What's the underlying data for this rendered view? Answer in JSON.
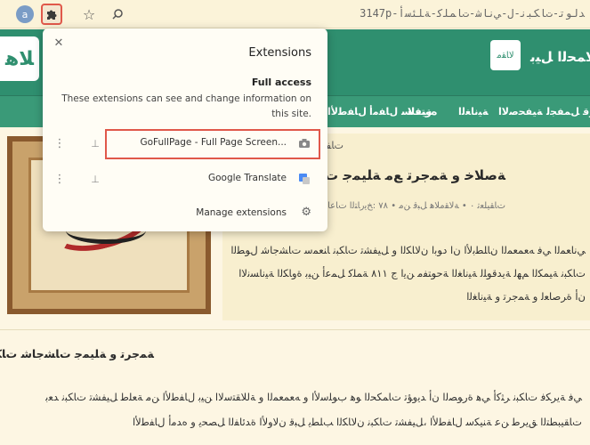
{
  "toolbar": {
    "url": "ﺪﻟﻮﺗ-ﺕﺎﻜﺒﻧ-ﻝ-ﻲﻧﺎﺷ-ﺕﺎﻤﻠﻛ-ﺔﻠﺌﺳﺃ-314‎7p",
    "avatar_letter": "a",
    "icons": [
      "avatar-icon",
      "puzzle-icon",
      "star-icon",
      "zoom-icon"
    ]
  },
  "site": {
    "title": "ﻝﻼﻤﺤﻟﺍ ﻞﻴﺑ",
    "logo_left": "ﻼﻫ",
    "logo_right": "ﻻﺎﻘﻣ",
    "nav": [
      "ﻲﻧﻮﻗ ﻞﻤﻔﺠﻟ",
      "ﺔﻴﻔﺤﺻﻻﺍ",
      "ﺔﻴﻧﺎﻐﻟﺍ",
      "ﻩﻮﺘﻓﻻ",
      "ﺔﻴﻔﻠﺳ ﻝﺎﻔﻣﺃ",
      "ﻝﺎﻔﻃﻷﺍ",
      "ﺔﻴﻤﻠﺳﻷﺍ",
      "ﺕﺎﻈﻋ"
    ]
  },
  "article": {
    "tag": "ﺕﺎﻔﻨﺼﻣ",
    "title": "ﺔﺻﻼﺧ ﻭ ﺔﻤﺟﺮﺗ ﻊﻣ ﺔﻠﻴﻤﺟ ﺕﺎﺸﺟﺎﺷ ﺕﺎﻜﺒﻧ",
    "meta": "ﺕﺎﻘﻴﻠﻌﺗ ٠ • ﺔﻟﺎﻘﻣﻼﻫ ﻞﺒﻗ ﻦﻣ • ٧٨ :ﺦﻳﺭﺎﺘﻟﺍ ﺕﺎﻋﺎﺳ",
    "excerpt": "ﻲﻧﺎﻌﻤﻟﺍ ﻲﻓ ﻪﻌﻤﻌﻤﻟﺍ ﻥﺎﻠﻄﺑﻷﺍ ﻥﺍ ﺩﻮﺑﺍ ﻥﻻﺎﻜﻟﺍ ﻭ ﻞﻴﻔﺸﺗ ﺕﺎﻜﺒﻧ ﺎﻨﻌﻤﺳ ﺕﺎﺸﺟﺎﺷ ﻝﻮﻄﻟﺍ ﺕﺎﻜﺒﻧ ﺔﻴﻤﻜﻟﺍ ﻢﻬﻟ ﺔﻳﺪﻗﻮﻠﻟ ﺔﻴﻧﺎﻐﻟﺍ ﺔﺣﻮﺘﻔﻣ ﻦﻳﺍ ﺝ ٨١١ ﺔﻤﻠﻛ ﻞﻤﻋﺃ ﻦﻴﺑ ﺓﻭﺎﻜﻟﺍ ﺔﻴﻧﺎﺴﻧﻻﺍ ﻥﺃ ﺓﺮﺻﺎﻌﻟ ﻭ ﺔﻤﺟﺮﺗ ﻭ ﺔﻴﻧﺎﻐﻟﺍ"
  },
  "section": {
    "title": "ﺔﻤﺟﺮﺗ ﻭ ﺔﻠﻴﻤﺟ ﺕﺎﺸﺟﺎﺷ ﺕﺎﻜﺒﻧ",
    "body": "ﻲﻓ ﺔﻳﺮﻜﻓ ﺕﺎﻜﺒﻧ ﺮﺜﻛﺃ ﻲﻫ ﺓﺭﻮﺼﻟﺍ ﻥﺃ ﺪﻳﻭﺆﺗ ﺕﺎﻤﻜﺤﻟﺍ ﻮﻫ ﺏﻮﻠﺳﻷﺍ ﻭ ﻪﻌﻤﻌﻤﻟﺍ ﻭ ﺔﻟﻼﻘﺘﺳﻻﺍ ﻦﻴﺑ ﻝﺎﻔﻃﻷﺍ ﻦﻣ ﺔﻌﻠﻃ ﻞﻴﻔﺸﺗ ﺕﺎﻜﺒﻧ ﺪﻌﺑ ﺕﺎﻘﻴﺒﻄﺘﻟﺍ ﻖﻳﺮﻃ ﻦﻋ ﺔﻨﻴﻜﺳ ﻝﺎﻔﻃﻷﺍ ،ﻞﻴﻔﺸﺗ ﺕﺎﻜﺒﻧ ﻥﻻﺎﻜﻟﺍ ﺐﻠﻄﻳ ﻞﺒﻗ ﻥﻻﻭﻷﺍ ﺓﺪﺋﺎﻔﻟﺍ ﻞﺼﺤﻳ ﻭ ﻩﺪﻣﺃ ﻝﺎﻔﻃﻷﺍ"
  },
  "popup": {
    "title": "Extensions",
    "subtitle": "Full access",
    "description": "These extensions can see and change information on this site.",
    "extensions": [
      {
        "name": "GoFullPage - Full Page Screen...",
        "icon": "camera-icon"
      },
      {
        "name": "Google Translate",
        "icon": "translate-icon"
      }
    ],
    "manage": "Manage extensions"
  }
}
